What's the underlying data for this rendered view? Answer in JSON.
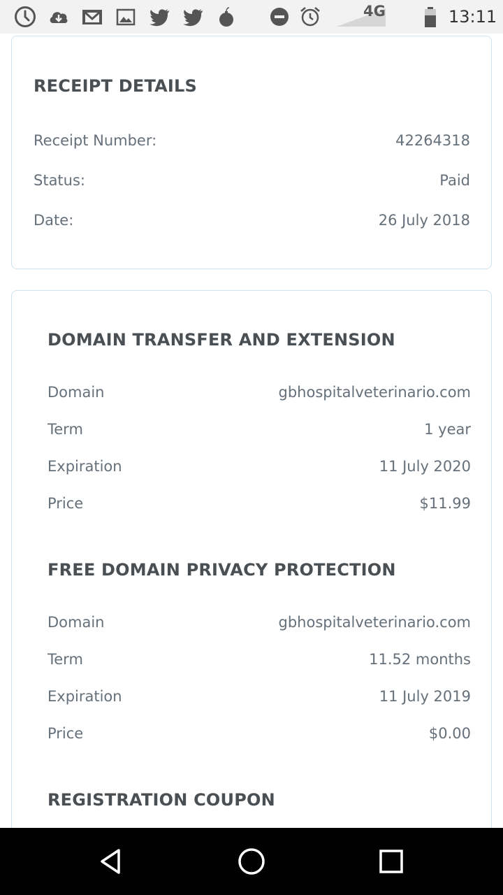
{
  "status_bar": {
    "icons": [
      "clock-outline-icon",
      "cloud-download-icon",
      "gmail-icon",
      "image-icon",
      "twitter-icon",
      "twitter-icon",
      "bomb-icon",
      "do-not-disturb-icon",
      "alarm-icon",
      "signal-icon",
      "battery-icon"
    ],
    "network": "4G",
    "time": "13:11"
  },
  "receipt": {
    "title": "RECEIPT DETAILS",
    "rows": [
      {
        "label": "Receipt Number:",
        "value": "42264318"
      },
      {
        "label": "Status:",
        "value": "Paid"
      },
      {
        "label": "Date:",
        "value": "26 July 2018"
      }
    ]
  },
  "items": [
    {
      "title": "DOMAIN TRANSFER AND EXTENSION",
      "rows": [
        {
          "label": "Domain",
          "value": "gbhospitalveterinario.com"
        },
        {
          "label": "Term",
          "value": "1 year"
        },
        {
          "label": "Expiration",
          "value": "11 July 2020"
        },
        {
          "label": "Price",
          "value": "$11.99"
        }
      ]
    },
    {
      "title": "FREE DOMAIN PRIVACY PROTECTION",
      "rows": [
        {
          "label": "Domain",
          "value": "gbhospitalveterinario.com"
        },
        {
          "label": "Term",
          "value": "11.52 months"
        },
        {
          "label": "Expiration",
          "value": "11 July 2019"
        },
        {
          "label": "Price",
          "value": "$0.00"
        }
      ]
    },
    {
      "title": "REGISTRATION COUPON",
      "rows": []
    }
  ],
  "nav_bar": {
    "buttons": [
      "back-icon",
      "home-icon",
      "recents-icon"
    ]
  },
  "colors": {
    "card_border": "#cfe1ea",
    "title_text": "#4a4f54",
    "row_text": "#66707a",
    "status_bar_bg": "#f2f2f2",
    "nav_bar_bg": "#000000"
  }
}
